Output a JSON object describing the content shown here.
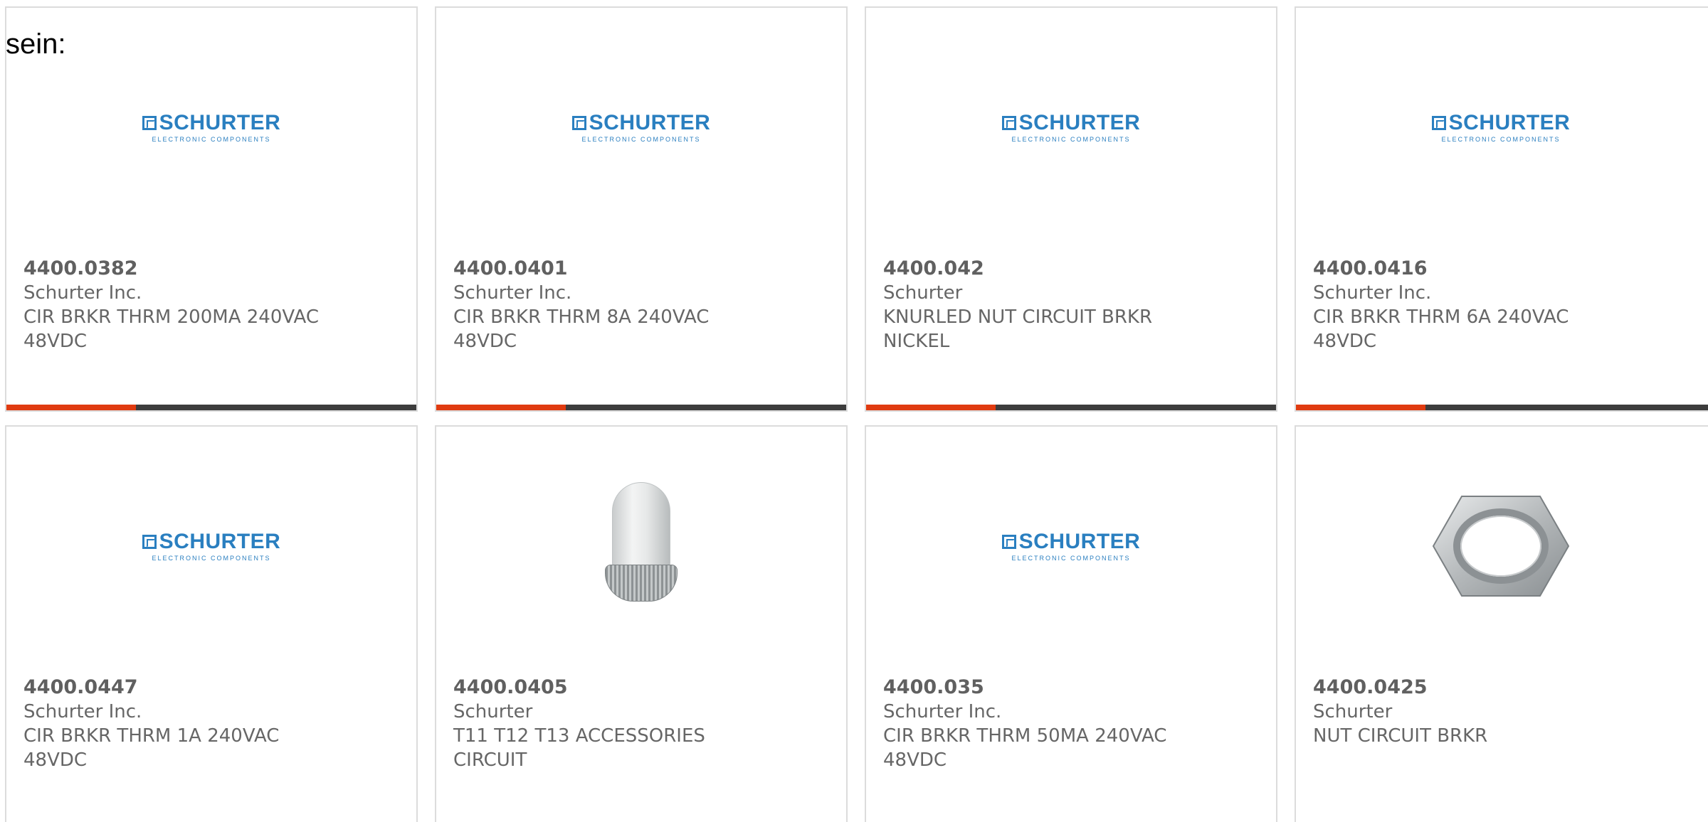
{
  "intro_text": "sein:",
  "logo": {
    "name": "SCHURTER",
    "subtitle": "ELECTRONIC COMPONENTS"
  },
  "colors": {
    "accent": "#e03b10",
    "bar": "#3d3d3d",
    "brand": "#2a7fc0"
  },
  "products": [
    {
      "part": "4400.0382",
      "maker": "Schurter Inc.",
      "desc": "CIR BRKR THRM 200MA 240VAC 48VDC",
      "image": "schurter-logo"
    },
    {
      "part": "4400.0401",
      "maker": "Schurter Inc.",
      "desc": "CIR BRKR THRM 8A 240VAC 48VDC",
      "image": "schurter-logo"
    },
    {
      "part": "4400.042",
      "maker": "Schurter",
      "desc": "KNURLED NUT CIRCUIT BRKR NICKEL",
      "image": "schurter-logo"
    },
    {
      "part": "4400.0416",
      "maker": "Schurter Inc.",
      "desc": "CIR BRKR THRM 6A 240VAC 48VDC",
      "image": "schurter-logo"
    },
    {
      "part": "4400.0447",
      "maker": "Schurter Inc.",
      "desc": "CIR BRKR THRM 1A 240VAC 48VDC",
      "image": "schurter-logo"
    },
    {
      "part": "4400.0405",
      "maker": "Schurter",
      "desc": "T11 T12 T13 ACCESSORIES CIRCUIT",
      "image": "glass-cover-photo"
    },
    {
      "part": "4400.035",
      "maker": "Schurter Inc.",
      "desc": "CIR BRKR THRM 50MA 240VAC 48VDC",
      "image": "schurter-logo"
    },
    {
      "part": "4400.0425",
      "maker": "Schurter",
      "desc": "NUT CIRCUIT BRKR",
      "image": "hex-nut-photo"
    }
  ]
}
